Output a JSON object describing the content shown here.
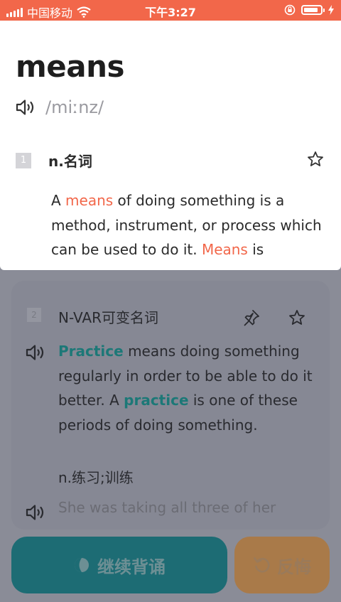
{
  "status_bar": {
    "carrier": "中国移动",
    "time": "下午3:27",
    "battery_level": 0.85
  },
  "entry": {
    "word": "means",
    "phonetic": "/miːnz/",
    "sense1": {
      "number": "1",
      "pos": "n.名词",
      "definition": {
        "t1": "A ",
        "h1": "means",
        "t2": " of doing something is a method, instrument, or process which can be used to do it. ",
        "h2": "Means",
        "t3": " is"
      }
    },
    "sense2": {
      "number": "2",
      "pos": "N-VAR可变名词",
      "definition": {
        "h1": "Practice",
        "t1": " means doing something regularly in order to be able to do it better. A ",
        "h2": "practice",
        "t2": " is one of these periods of doing something."
      },
      "translation": "n.练习;训练",
      "example": "She was taking all three of her"
    }
  },
  "buttons": {
    "continue_label": "继续背诵",
    "undo_label": "反悔"
  },
  "colors": {
    "accent_red": "#f2674a",
    "accent_teal": "#1d7d7c",
    "continue_bg": "#1d6c74",
    "undo_bg": "#a97a49"
  },
  "icons": [
    "signal-icon",
    "wifi-icon",
    "lock-rotation-icon",
    "battery-icon",
    "charging-icon",
    "speaker-icon",
    "star-icon",
    "pin-icon",
    "leaf-icon",
    "undo-icon"
  ]
}
